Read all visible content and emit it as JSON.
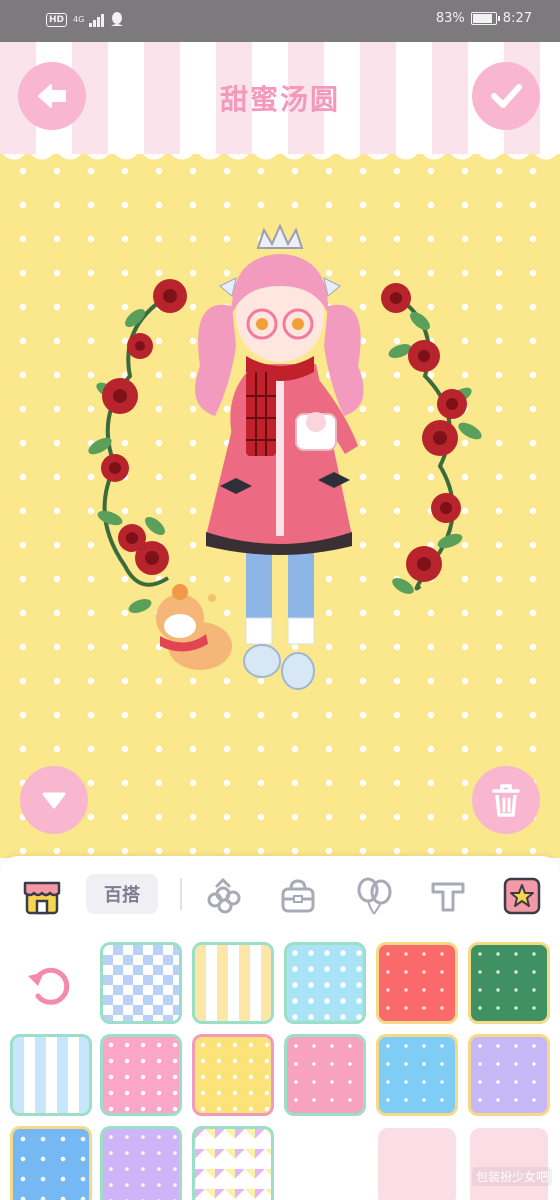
{
  "status_bar": {
    "hd": "HD",
    "network": "4G",
    "battery": "83%",
    "time": "8:27"
  },
  "header": {
    "title": "甜蜜汤圆",
    "back_icon": "arrow-left-icon",
    "confirm_icon": "checkmark-icon"
  },
  "stage": {
    "down_icon": "triangle-down-icon",
    "delete_icon": "trash-icon"
  },
  "panel": {
    "tabs": [
      {
        "icon": "shop-icon"
      },
      {
        "label": "百搭"
      },
      {
        "icon": "flower-accessory-icon"
      },
      {
        "icon": "bag-icon"
      },
      {
        "icon": "balloon-icon"
      },
      {
        "icon": "text-icon"
      },
      {
        "icon": "star-frame-icon"
      }
    ],
    "reset_icon": "refresh-icon",
    "backgrounds": [
      {
        "name": "blue-diamond",
        "border": "#9be0c6"
      },
      {
        "name": "cream-stripe",
        "border": "#9be0c6"
      },
      {
        "name": "blue-drops",
        "border": "#9be0c6"
      },
      {
        "name": "red-sparkle",
        "border": "#f6d986"
      },
      {
        "name": "green-sparkle",
        "border": "#f6d986"
      },
      {
        "name": "blue-stripe",
        "border": "#9be0c6"
      },
      {
        "name": "pink-dots",
        "border": "#9be0c6"
      },
      {
        "name": "yellow-dots",
        "border": "#f39aba"
      },
      {
        "name": "pink-dots-2",
        "border": "#9be0c6"
      },
      {
        "name": "sky-sparkle",
        "border": "#f6d986"
      },
      {
        "name": "lavender-sparkle",
        "border": "#f6d986"
      },
      {
        "name": "blue-stars",
        "border": "#f6d986"
      },
      {
        "name": "purple-dots",
        "border": "#9be0c6"
      },
      {
        "name": "pastel-zigzag",
        "border": "#9be0c6"
      }
    ],
    "watermark": "包装扮少女吧"
  },
  "colors": {
    "accent_pink": "#f39aba",
    "button_pink": "#f8b7cf",
    "stage_yellow": "#fbe78c",
    "tab_icon": "#a9a9b8"
  }
}
